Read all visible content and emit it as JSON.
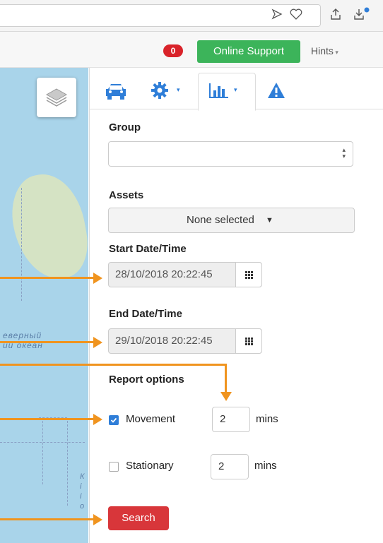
{
  "browser": {
    "icons": [
      "send-icon",
      "heart-icon",
      "share-icon",
      "download-icon"
    ]
  },
  "header": {
    "notification_count": "0",
    "support_label": "Online Support",
    "hints_label": "Hints",
    "colors": {
      "badge": "#d9232a",
      "support": "#3cb45a"
    }
  },
  "map": {
    "ocean_label_line1": "еверный",
    "ocean_label_line2": "ий океан",
    "edge_letters": "К\nі\nі\nо",
    "layers_icon": "layers-icon"
  },
  "tabs": [
    {
      "icon": "car-icon"
    },
    {
      "icon": "gear-icon",
      "dropdown": true
    },
    {
      "icon": "bar-chart-icon",
      "dropdown": true,
      "active": true
    },
    {
      "icon": "warning-icon"
    }
  ],
  "form": {
    "group_label": "Group",
    "group_value": "",
    "assets_label": "Assets",
    "assets_value": "None selected",
    "start_label": "Start Date/Time",
    "start_value": "28/10/2018 20:22:45",
    "end_label": "End Date/Time",
    "end_value": "29/10/2018 20:22:45",
    "report_options_label": "Report options",
    "movement_label": "Movement",
    "movement_checked": true,
    "movement_value": "2",
    "stationary_label": "Stationary",
    "stationary_checked": false,
    "stationary_value": "2",
    "mins_label": "mins",
    "search_label": "Search",
    "colors": {
      "search": "#d8363a",
      "accent": "#2f7ed8",
      "callout": "#f0941f"
    }
  }
}
